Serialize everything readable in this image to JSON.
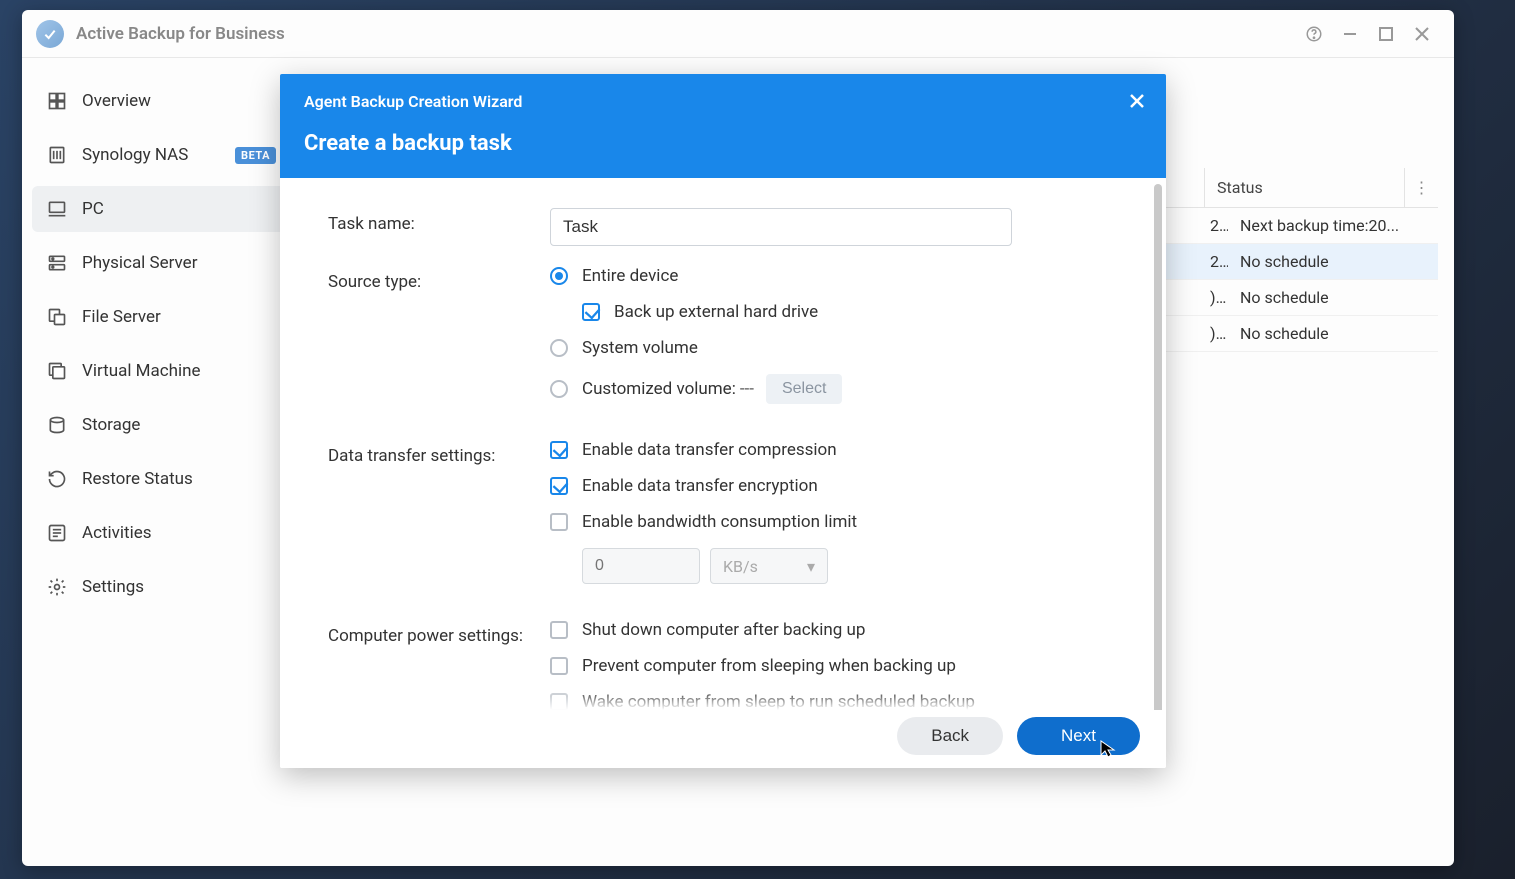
{
  "app": {
    "title": "Active Backup for Business"
  },
  "sidebar": {
    "items": [
      {
        "label": "Overview"
      },
      {
        "label": "Synology NAS",
        "badge": "BETA"
      },
      {
        "label": "PC",
        "active": true
      },
      {
        "label": "Physical Server"
      },
      {
        "label": "File Server"
      },
      {
        "label": "Virtual Machine"
      },
      {
        "label": "Storage"
      },
      {
        "label": "Restore Status"
      },
      {
        "label": "Activities"
      },
      {
        "label": "Settings"
      }
    ]
  },
  "table": {
    "columns": {
      "status": "Status"
    },
    "rows": [
      {
        "time": "2...",
        "status": "Next backup time:20..."
      },
      {
        "time": "2...",
        "status": "No schedule",
        "selected": true
      },
      {
        "time": ") ...",
        "status": "No schedule"
      },
      {
        "time": ") ...",
        "status": "No schedule"
      }
    ]
  },
  "modal": {
    "wizard_title": "Agent Backup Creation Wizard",
    "heading": "Create a backup task",
    "labels": {
      "task_name": "Task name:",
      "source_type": "Source type:",
      "data_transfer": "Data transfer settings:",
      "power": "Computer power settings:"
    },
    "task_name_value": "Task",
    "source": {
      "entire": "Entire device",
      "external": "Back up external hard drive",
      "system": "System volume",
      "custom_label": "Customized volume:",
      "custom_value": "---",
      "select_btn": "Select"
    },
    "transfer": {
      "compression": "Enable data transfer compression",
      "encryption": "Enable data transfer encryption",
      "bandwidth": "Enable bandwidth consumption limit",
      "bw_value": "0",
      "bw_unit": "KB/s"
    },
    "power": {
      "shutdown": "Shut down computer after backing up",
      "prevent_sleep": "Prevent computer from sleeping when backing up",
      "wake": "Wake computer from sleep to run scheduled backup"
    },
    "footer": {
      "back": "Back",
      "next": "Next"
    }
  }
}
